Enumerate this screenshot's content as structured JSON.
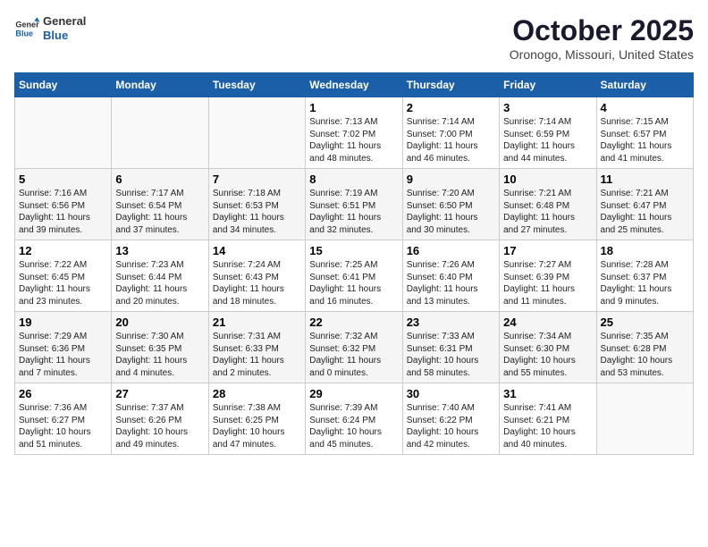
{
  "header": {
    "logo_line1": "General",
    "logo_line2": "Blue",
    "month": "October 2025",
    "location": "Oronogo, Missouri, United States"
  },
  "weekdays": [
    "Sunday",
    "Monday",
    "Tuesday",
    "Wednesday",
    "Thursday",
    "Friday",
    "Saturday"
  ],
  "weeks": [
    [
      {
        "day": "",
        "info": ""
      },
      {
        "day": "",
        "info": ""
      },
      {
        "day": "",
        "info": ""
      },
      {
        "day": "1",
        "info": "Sunrise: 7:13 AM\nSunset: 7:02 PM\nDaylight: 11 hours\nand 48 minutes."
      },
      {
        "day": "2",
        "info": "Sunrise: 7:14 AM\nSunset: 7:00 PM\nDaylight: 11 hours\nand 46 minutes."
      },
      {
        "day": "3",
        "info": "Sunrise: 7:14 AM\nSunset: 6:59 PM\nDaylight: 11 hours\nand 44 minutes."
      },
      {
        "day": "4",
        "info": "Sunrise: 7:15 AM\nSunset: 6:57 PM\nDaylight: 11 hours\nand 41 minutes."
      }
    ],
    [
      {
        "day": "5",
        "info": "Sunrise: 7:16 AM\nSunset: 6:56 PM\nDaylight: 11 hours\nand 39 minutes."
      },
      {
        "day": "6",
        "info": "Sunrise: 7:17 AM\nSunset: 6:54 PM\nDaylight: 11 hours\nand 37 minutes."
      },
      {
        "day": "7",
        "info": "Sunrise: 7:18 AM\nSunset: 6:53 PM\nDaylight: 11 hours\nand 34 minutes."
      },
      {
        "day": "8",
        "info": "Sunrise: 7:19 AM\nSunset: 6:51 PM\nDaylight: 11 hours\nand 32 minutes."
      },
      {
        "day": "9",
        "info": "Sunrise: 7:20 AM\nSunset: 6:50 PM\nDaylight: 11 hours\nand 30 minutes."
      },
      {
        "day": "10",
        "info": "Sunrise: 7:21 AM\nSunset: 6:48 PM\nDaylight: 11 hours\nand 27 minutes."
      },
      {
        "day": "11",
        "info": "Sunrise: 7:21 AM\nSunset: 6:47 PM\nDaylight: 11 hours\nand 25 minutes."
      }
    ],
    [
      {
        "day": "12",
        "info": "Sunrise: 7:22 AM\nSunset: 6:45 PM\nDaylight: 11 hours\nand 23 minutes."
      },
      {
        "day": "13",
        "info": "Sunrise: 7:23 AM\nSunset: 6:44 PM\nDaylight: 11 hours\nand 20 minutes."
      },
      {
        "day": "14",
        "info": "Sunrise: 7:24 AM\nSunset: 6:43 PM\nDaylight: 11 hours\nand 18 minutes."
      },
      {
        "day": "15",
        "info": "Sunrise: 7:25 AM\nSunset: 6:41 PM\nDaylight: 11 hours\nand 16 minutes."
      },
      {
        "day": "16",
        "info": "Sunrise: 7:26 AM\nSunset: 6:40 PM\nDaylight: 11 hours\nand 13 minutes."
      },
      {
        "day": "17",
        "info": "Sunrise: 7:27 AM\nSunset: 6:39 PM\nDaylight: 11 hours\nand 11 minutes."
      },
      {
        "day": "18",
        "info": "Sunrise: 7:28 AM\nSunset: 6:37 PM\nDaylight: 11 hours\nand 9 minutes."
      }
    ],
    [
      {
        "day": "19",
        "info": "Sunrise: 7:29 AM\nSunset: 6:36 PM\nDaylight: 11 hours\nand 7 minutes."
      },
      {
        "day": "20",
        "info": "Sunrise: 7:30 AM\nSunset: 6:35 PM\nDaylight: 11 hours\nand 4 minutes."
      },
      {
        "day": "21",
        "info": "Sunrise: 7:31 AM\nSunset: 6:33 PM\nDaylight: 11 hours\nand 2 minutes."
      },
      {
        "day": "22",
        "info": "Sunrise: 7:32 AM\nSunset: 6:32 PM\nDaylight: 11 hours\nand 0 minutes."
      },
      {
        "day": "23",
        "info": "Sunrise: 7:33 AM\nSunset: 6:31 PM\nDaylight: 10 hours\nand 58 minutes."
      },
      {
        "day": "24",
        "info": "Sunrise: 7:34 AM\nSunset: 6:30 PM\nDaylight: 10 hours\nand 55 minutes."
      },
      {
        "day": "25",
        "info": "Sunrise: 7:35 AM\nSunset: 6:28 PM\nDaylight: 10 hours\nand 53 minutes."
      }
    ],
    [
      {
        "day": "26",
        "info": "Sunrise: 7:36 AM\nSunset: 6:27 PM\nDaylight: 10 hours\nand 51 minutes."
      },
      {
        "day": "27",
        "info": "Sunrise: 7:37 AM\nSunset: 6:26 PM\nDaylight: 10 hours\nand 49 minutes."
      },
      {
        "day": "28",
        "info": "Sunrise: 7:38 AM\nSunset: 6:25 PM\nDaylight: 10 hours\nand 47 minutes."
      },
      {
        "day": "29",
        "info": "Sunrise: 7:39 AM\nSunset: 6:24 PM\nDaylight: 10 hours\nand 45 minutes."
      },
      {
        "day": "30",
        "info": "Sunrise: 7:40 AM\nSunset: 6:22 PM\nDaylight: 10 hours\nand 42 minutes."
      },
      {
        "day": "31",
        "info": "Sunrise: 7:41 AM\nSunset: 6:21 PM\nDaylight: 10 hours\nand 40 minutes."
      },
      {
        "day": "",
        "info": ""
      }
    ]
  ]
}
